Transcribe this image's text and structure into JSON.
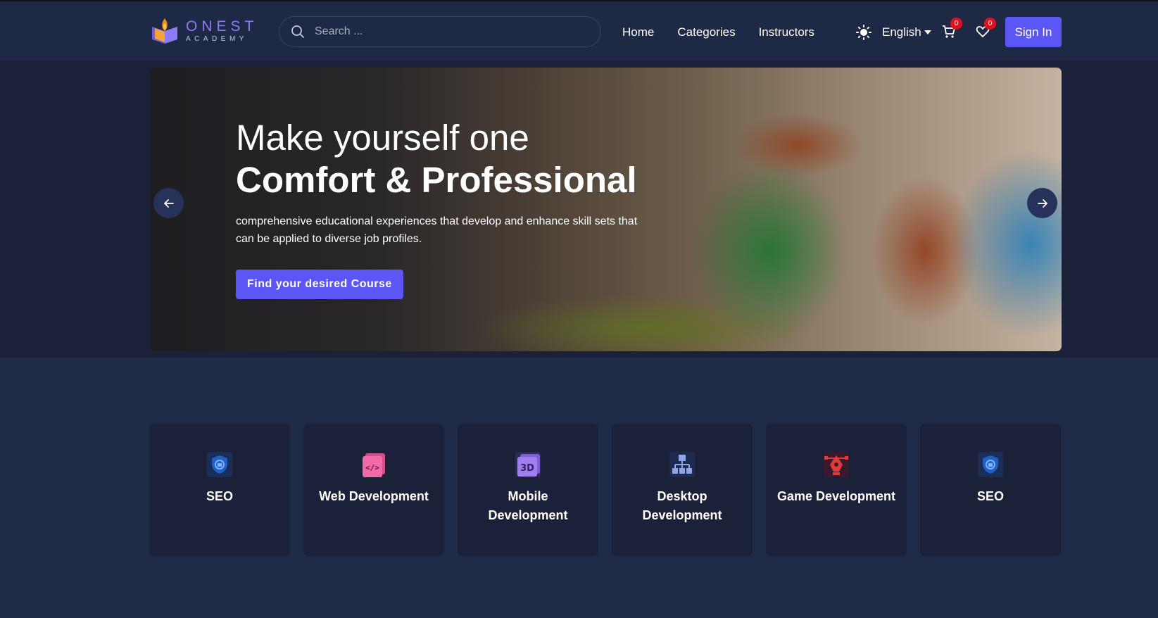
{
  "header": {
    "logo": {
      "name": "ONEST",
      "tagline": "ACADEMY"
    },
    "search": {
      "placeholder": "Search ..."
    },
    "nav": [
      {
        "label": "Home"
      },
      {
        "label": "Categories"
      },
      {
        "label": "Instructors"
      }
    ],
    "language": "English",
    "cart_count": "0",
    "wishlist_count": "0",
    "signin_label": "Sign In"
  },
  "hero": {
    "line1": "Make yourself one",
    "line2": "Comfort & Professional",
    "subtitle": "comprehensive educational experiences that develop and enhance skill sets that can be applied to diverse job profiles.",
    "cta_label": "Find your desired Course"
  },
  "categories": [
    {
      "label": "SEO",
      "icon": "shield-icon"
    },
    {
      "label": "Web Development",
      "icon": "code-window-icon"
    },
    {
      "label": "Mobile Development",
      "icon": "3d-box-icon"
    },
    {
      "label": "Desktop Development",
      "icon": "hierarchy-icon"
    },
    {
      "label": "Game Development",
      "icon": "pen-tool-icon"
    },
    {
      "label": "SEO",
      "icon": "shield-icon"
    }
  ],
  "colors": {
    "accent": "#5b56f5",
    "badge": "#e3101e",
    "background": "#1f2a47"
  }
}
